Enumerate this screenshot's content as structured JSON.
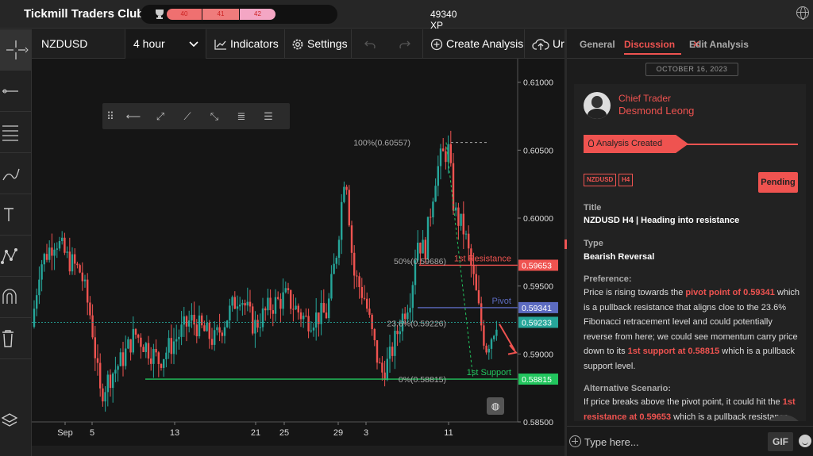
{
  "app": {
    "title": "Tickmill Traders Club",
    "xp_levels": [
      "40",
      "41",
      "42"
    ],
    "xp_total": "49340 XP"
  },
  "toolbar": {
    "symbol": "NZDUSD",
    "timeframe": "4 hour",
    "indicators_label": "Indicators",
    "settings_label": "Settings",
    "create_analysis_label": "Create Analysis",
    "upload_label": "Ur"
  },
  "chart_data": {
    "type": "candlestick",
    "symbol": "NZDUSD",
    "timeframe": "4 hour",
    "ylim": [
      0.585,
      0.6115
    ],
    "y_ticks": [
      "0.61000",
      "0.60500",
      "0.60000",
      "0.59500",
      "0.59000",
      "0.58500"
    ],
    "x_ticks": [
      "Sep",
      "5",
      "13",
      "21",
      "25",
      "29",
      "3",
      "11"
    ],
    "levels": [
      {
        "name": "1st Resistance",
        "value": "0.59653",
        "color": "#ef5350"
      },
      {
        "name": "Pivot",
        "value": "0.59341",
        "color": "#5c6bc0"
      },
      {
        "name": "",
        "value": "0.59233",
        "color": "#26a69a"
      },
      {
        "name": "1st Support",
        "value": "0.58815",
        "color": "#22c55e"
      }
    ],
    "fibonacci": [
      {
        "label": "100%(0.60557)",
        "value": 0.60557
      },
      {
        "label": "50%(0.59686)",
        "value": 0.59686
      },
      {
        "label": "23.6%(0.59226)",
        "value": 0.59226
      },
      {
        "label": "0%(0.58815)",
        "value": 0.58815
      }
    ],
    "colors": {
      "up": "#26a69a",
      "down": "#ef5350"
    }
  },
  "panel": {
    "tabs": [
      "General",
      "Discussion",
      "Edit Analysis"
    ],
    "date": "OCTOBER 16, 2023",
    "author_role": "Chief Trader",
    "author_name": "Desmond Leong",
    "status_banner": "Analysis Created",
    "tags": [
      "NZDUSD",
      "H4"
    ],
    "status": "Pending",
    "title_label": "Title",
    "title_value": "NZDUSD H4 | Heading into resistance",
    "type_label": "Type",
    "type_value": "Bearish Reversal",
    "preference_label": "Preference:",
    "preference_parts": [
      "Price is rising towards the ",
      "pivot point of 0.59341",
      " which is a pullback resistance that aligns cloe to the 23.6% Fibonacci retracement level and could potentially reverse from here; we could see momentum carry price down to its ",
      "1st support at 0.58815",
      " which is a pullback support level."
    ],
    "alt_label": "Alternative Scenario:",
    "alt_parts": [
      "If price breaks above the pivot point, it could hit the ",
      "1st resistance at 0.59653",
      " which is a pullback resistance"
    ],
    "input_placeholder": "Type here...",
    "gif_label": "GIF"
  }
}
